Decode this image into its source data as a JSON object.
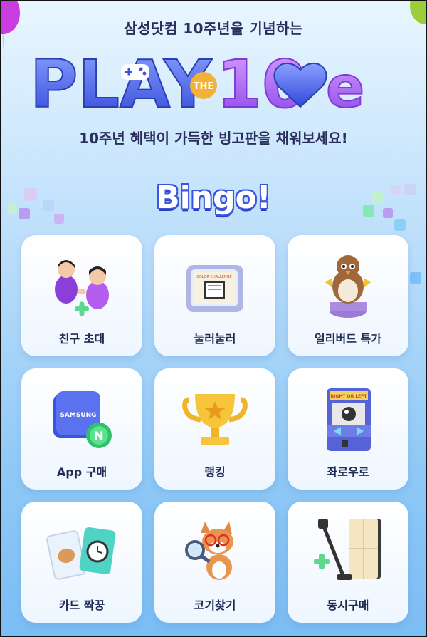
{
  "header": {
    "subtitle": "삼성닷컴 10주년을 기념하는",
    "logo_text": "PLAY THE 10ve",
    "tagline": "10주년 혜택이 가득한 빙고판을 채워보세요!"
  },
  "bingo_title": "Bingo!",
  "colors": {
    "brand_blue": "#3b54e0",
    "logo_purple": "#9b5cf0",
    "text_dark": "#1f2a55"
  },
  "cards": [
    {
      "label": "친구 초대",
      "icon": "friends-invite-icon"
    },
    {
      "label": "눌러눌러",
      "icon": "tv-press-icon"
    },
    {
      "label": "얼리버드 특가",
      "icon": "bird-earlybird-icon"
    },
    {
      "label": "App 구매",
      "icon": "samsung-app-icon"
    },
    {
      "label": "랭킹",
      "icon": "trophy-icon"
    },
    {
      "label": "좌로우로",
      "icon": "arcade-machine-icon"
    },
    {
      "label": "카드 짝꿍",
      "icon": "card-match-icon"
    },
    {
      "label": "코기찾기",
      "icon": "corgi-icon"
    },
    {
      "label": "동시구매",
      "icon": "vacuum-fridge-icon"
    }
  ]
}
